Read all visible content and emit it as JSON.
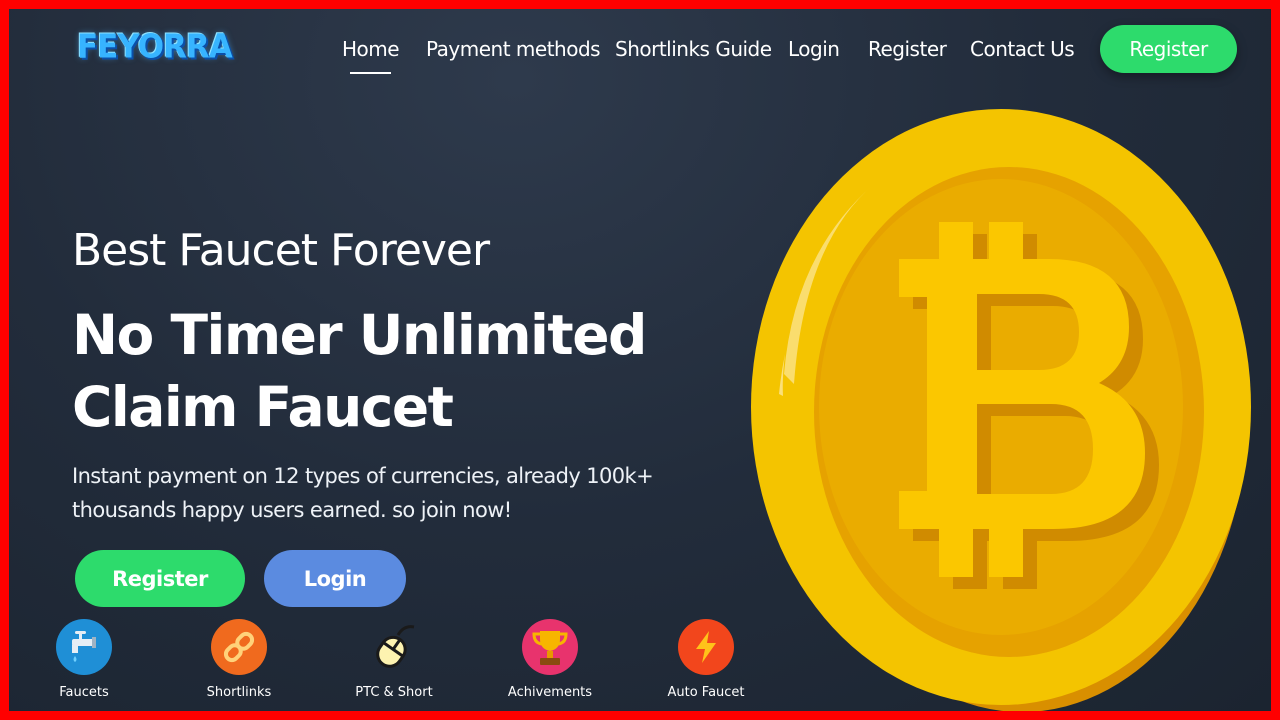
{
  "header": {
    "logo": "FEYORRA",
    "nav": [
      {
        "label": "Home",
        "active": true
      },
      {
        "label": "Payment methods",
        "active": false
      },
      {
        "label": "Shortlinks Guide",
        "active": false
      },
      {
        "label": "Login",
        "active": false
      },
      {
        "label": "Register",
        "active": false
      },
      {
        "label": "Contact Us",
        "active": false
      }
    ],
    "cta_label": "Register"
  },
  "hero": {
    "subtitle": "Best Faucet Forever",
    "title_line1": "No Timer Unlimited",
    "title_line2": "Claim Faucet",
    "description_line1": "Instant payment on 12 types of currencies, already 100k+",
    "description_line2": "thousands happy users earned. so join now!",
    "register_label": "Register",
    "login_label": "Login"
  },
  "features": [
    {
      "label": "Faucets",
      "icon": "faucet-icon"
    },
    {
      "label": "Shortlinks",
      "icon": "link-icon"
    },
    {
      "label": "PTC & Short",
      "icon": "mouse-icon"
    },
    {
      "label": "Achivements",
      "icon": "trophy-icon"
    },
    {
      "label": "Auto Faucet",
      "icon": "lightning-icon"
    }
  ],
  "colors": {
    "frame_border": "#ff0000",
    "background": "#222c3b",
    "green": "#2ddb6c",
    "blue": "#5b8be0",
    "coin": "#f7c600"
  }
}
